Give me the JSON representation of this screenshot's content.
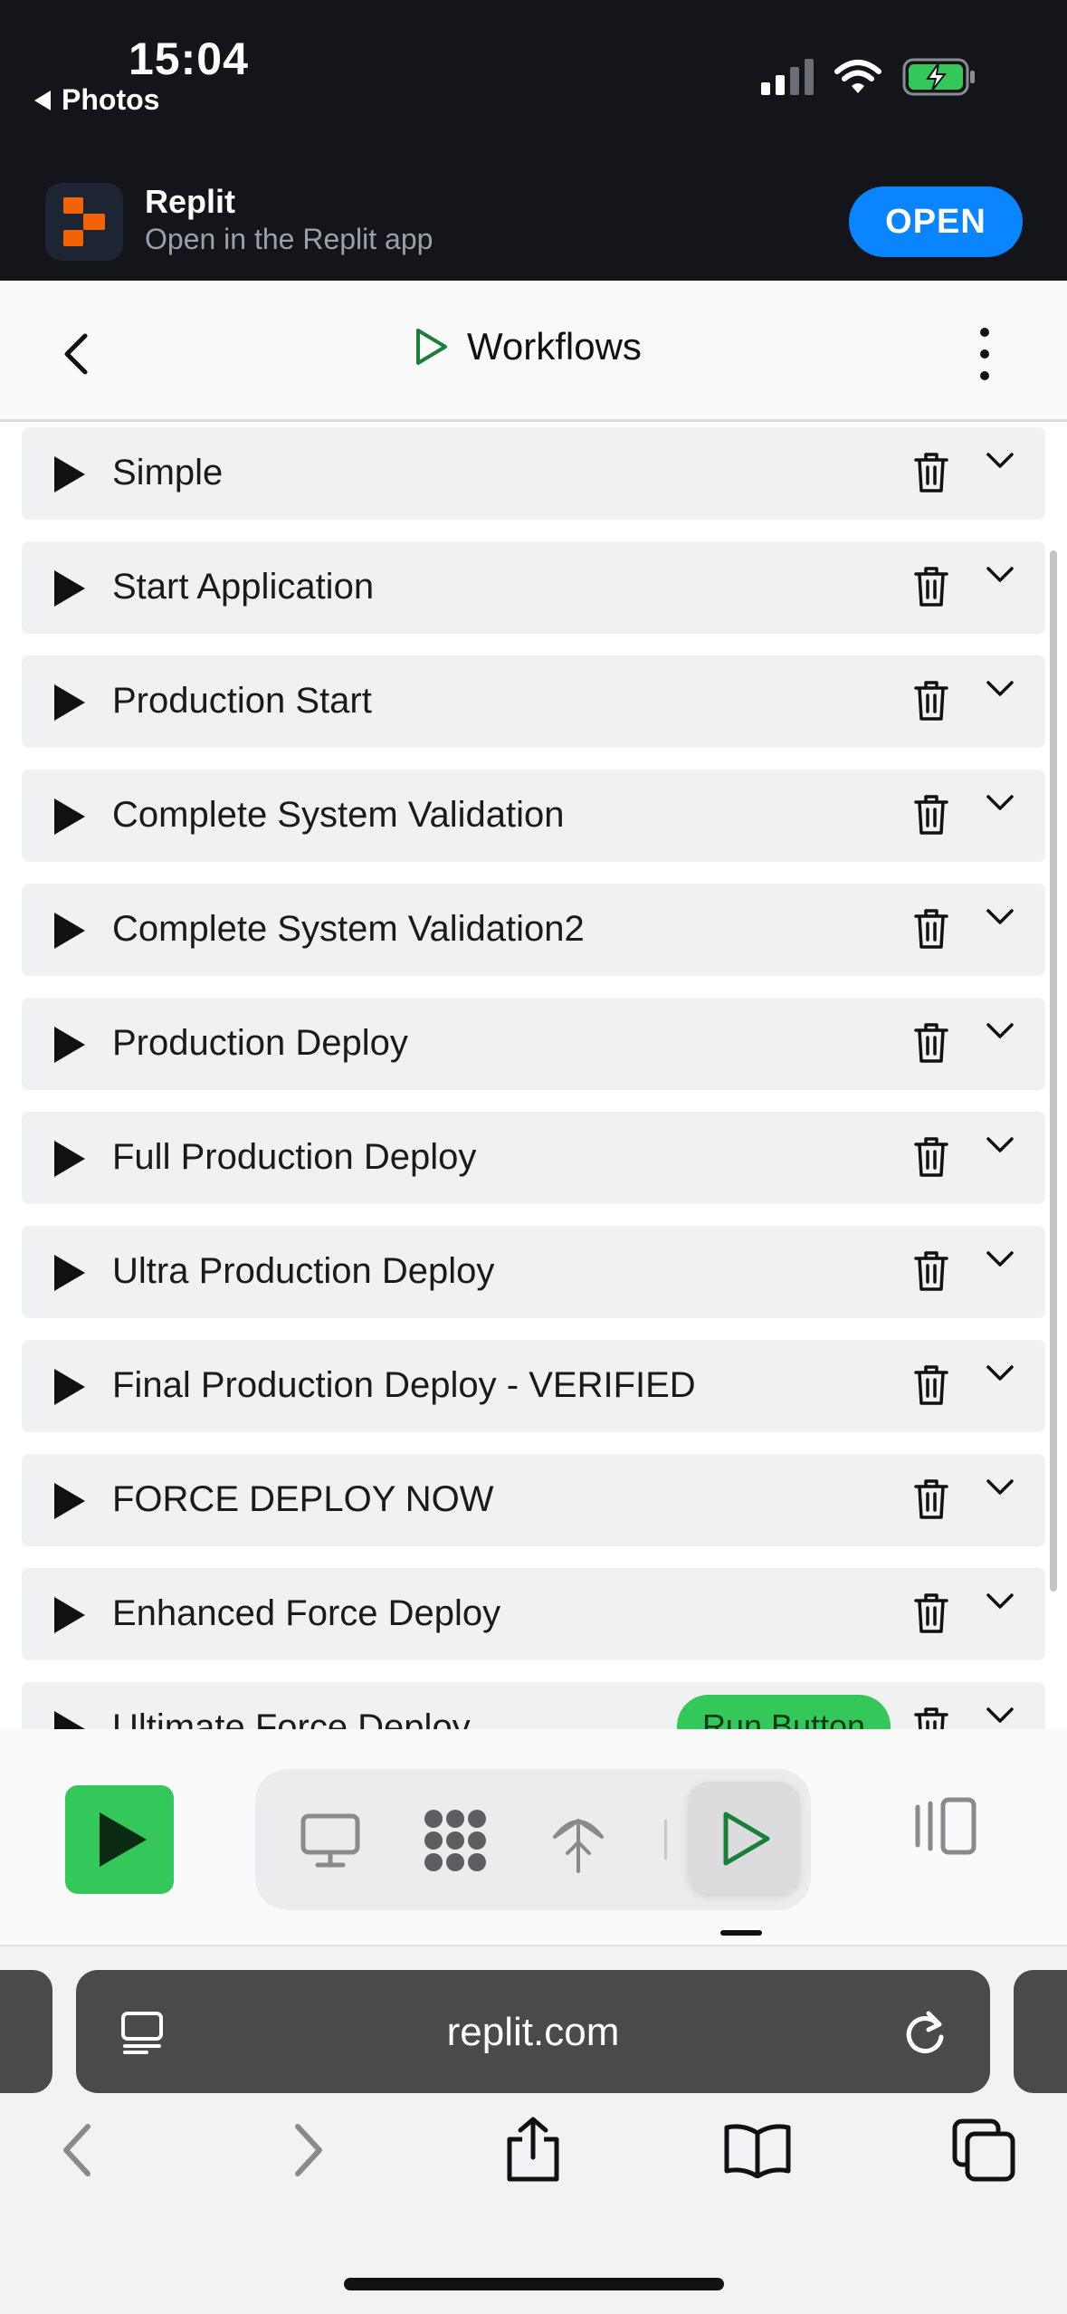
{
  "status_bar": {
    "time": "15:04",
    "back_app": "Photos"
  },
  "app_banner": {
    "title": "Replit",
    "subtitle": "Open in the Replit app",
    "open_label": "OPEN"
  },
  "header": {
    "title": "Workflows"
  },
  "workflows": [
    {
      "name": "Simple"
    },
    {
      "name": "Start Application"
    },
    {
      "name": "Production Start"
    },
    {
      "name": "Complete System Validation"
    },
    {
      "name": "Complete System Validation2"
    },
    {
      "name": "Production Deploy"
    },
    {
      "name": "Full Production Deploy"
    },
    {
      "name": "Ultra Production Deploy"
    },
    {
      "name": "Final Production Deploy - VERIFIED"
    },
    {
      "name": "FORCE DEPLOY NOW"
    },
    {
      "name": "Enhanced Force Deploy"
    },
    {
      "name": "Ultimate Force Deploy",
      "badge": "Run Button"
    }
  ],
  "browser": {
    "url": "replit.com"
  },
  "colors": {
    "accent_green": "#34c759",
    "open_blue": "#0a84ff",
    "dark_bar": "#13151a"
  }
}
